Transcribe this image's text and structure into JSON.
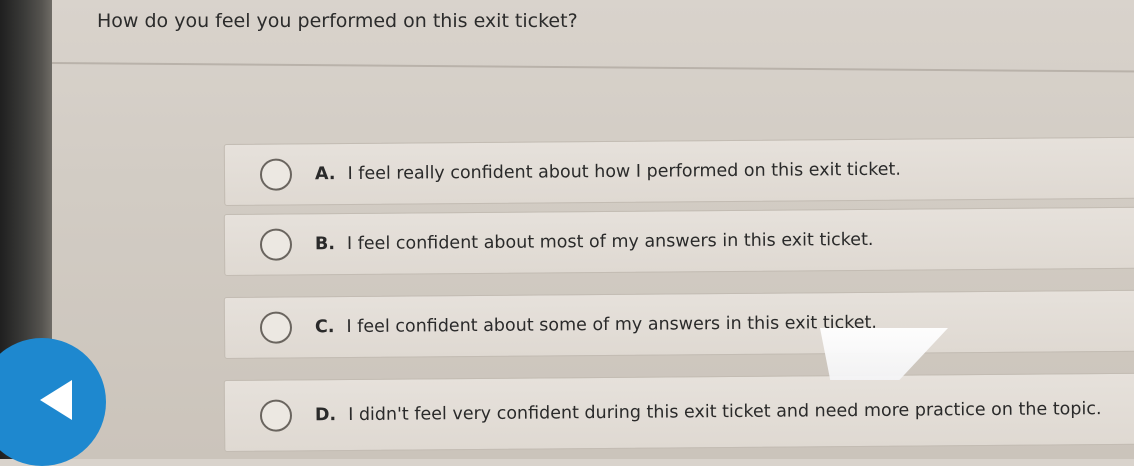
{
  "question": "How do you feel you performed on this exit ticket?",
  "options": [
    {
      "letter": "A.",
      "text": "I feel really confident about how I performed on this exit ticket."
    },
    {
      "letter": "B.",
      "text": "I feel confident about most of my answers in this exit ticket."
    },
    {
      "letter": "C.",
      "text": "I feel confident about some of my answers in this exit ticket."
    },
    {
      "letter": "D.",
      "text": "I didn't feel very confident during this exit ticket and need more practice on the topic."
    }
  ],
  "colors": {
    "back_button": "#1e88cf",
    "background": "#d6d0c9"
  },
  "icons": {
    "back": "left-triangle-icon",
    "radio": "radio-circle-icon"
  }
}
